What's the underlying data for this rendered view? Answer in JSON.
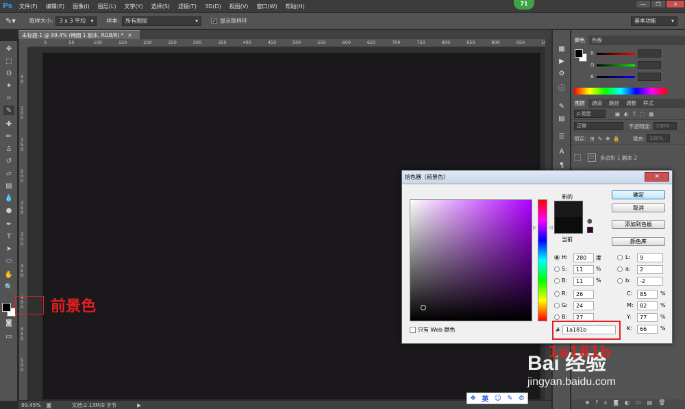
{
  "app": {
    "logo": "Ps",
    "menus": [
      "文件(F)",
      "编辑(E)",
      "图像(I)",
      "图层(L)",
      "文字(Y)",
      "选择(S)",
      "滤镜(T)",
      "3D(D)",
      "视图(V)",
      "窗口(W)",
      "帮助(H)"
    ],
    "badge": "71",
    "window_buttons": [
      "—",
      "❐",
      "✕"
    ]
  },
  "options": {
    "sample_size_label": "取样大小:",
    "sample_size_value": "3 x 3 平均",
    "sample_label": "样本:",
    "sample_value": "所有图层",
    "show_ring_label": "显示取样环",
    "show_ring_checked": true,
    "workspace": "基本功能"
  },
  "document": {
    "tab_title": "未标题-1 @ 99.4% (椭圆 1 副本, RGB/8) *",
    "canvas_color": "#1a181b",
    "ruler_h": [
      "0",
      "50",
      "100",
      "150",
      "200",
      "250",
      "300",
      "350",
      "400",
      "450",
      "500",
      "550",
      "600",
      "650",
      "700",
      "750",
      "800",
      "850",
      "900",
      "950",
      "1000"
    ],
    "ruler_v": [
      "5 0",
      "1 0 0",
      "1 5 0",
      "2 0 0",
      "2 5 0",
      "3 0 0",
      "3 5 0",
      "4 0 0",
      "4 5 0",
      "5 0 0"
    ]
  },
  "status": {
    "zoom": "99.45%",
    "doc_info": "文档:2.13M/0 字节"
  },
  "color_panel": {
    "tabs": [
      "颜色",
      "色板"
    ],
    "channels": [
      "R",
      "G",
      "B"
    ]
  },
  "layers_panel": {
    "tabs": [
      "图层",
      "通道",
      "路径",
      "调整",
      "样式"
    ],
    "filter_label": "ρ 类型",
    "blend_mode": "正常",
    "opacity_label": "不透明度:",
    "opacity_value": "100%",
    "lock_label": "锁定:",
    "fill_label": "填充:",
    "fill_value": "100%",
    "layer_name": "多边形 1 副本 2"
  },
  "picker": {
    "title": "拾色器（前景色）",
    "close": "✕",
    "new_label": "新的",
    "current_label": "当前",
    "buttons": {
      "ok": "确定",
      "cancel": "取消",
      "add_swatch": "添加到色板",
      "libraries": "颜色库"
    },
    "hsb": {
      "h_label": "H:",
      "h": "280",
      "h_unit": "度",
      "s_label": "S:",
      "s": "11",
      "s_unit": "%",
      "b_label": "B:",
      "b": "11",
      "b_unit": "%"
    },
    "rgb": {
      "r_label": "R:",
      "r": "26",
      "g_label": "G:",
      "g": "24",
      "b_label": "B:",
      "b": "27"
    },
    "lab": {
      "l_label": "L:",
      "l": "9",
      "a_label": "a:",
      "a": "2",
      "b_label": "b:",
      "b": "-2"
    },
    "cmyk": {
      "c_label": "C:",
      "c": "85",
      "m_label": "M:",
      "m": "82",
      "y_label": "Y:",
      "y": "77",
      "k_label": "K:",
      "k": "66",
      "unit": "%"
    },
    "hex_label": "#",
    "hex": "1a181b",
    "web_only_label": "只有 Web 颜色",
    "new_color": "#1a181b",
    "current_color": "#0d0c0d"
  },
  "annotations": {
    "foreground_label": "前景色",
    "overlay_text": "1a181b"
  },
  "watermark": {
    "brand": "Bai 经验",
    "url": "jingyan.baidu.com"
  },
  "ime": [
    "英"
  ]
}
